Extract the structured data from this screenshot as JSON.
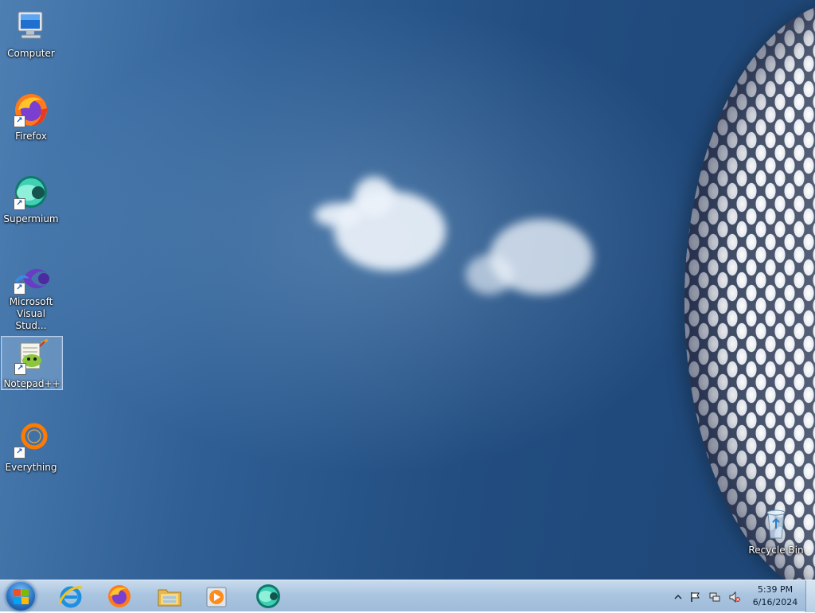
{
  "desktop": {
    "icons": [
      {
        "label": "Computer",
        "icon": "computer-icon"
      },
      {
        "label": "Firefox",
        "icon": "firefox-icon"
      },
      {
        "label": "Supermium",
        "icon": "supermium-icon"
      },
      {
        "label_line1": "Microsoft",
        "label_line2": "Visual Stud...",
        "icon": "visual-studio-icon"
      },
      {
        "label": "Notepad++",
        "icon": "notepad-plus-plus-icon",
        "selected": true
      },
      {
        "label": "Everything",
        "icon": "everything-icon"
      },
      {
        "label": "Recycle Bin",
        "icon": "recycle-bin-icon"
      }
    ]
  },
  "taskbar": {
    "start": {
      "icon": "windows-start-icon"
    },
    "pinned": [
      {
        "icon": "internet-explorer-icon"
      },
      {
        "icon": "firefox-icon"
      },
      {
        "icon": "file-explorer-icon"
      },
      {
        "icon": "media-player-icon"
      },
      {
        "icon": "supermium-icon"
      }
    ],
    "tray": {
      "icons": [
        "show-hidden-icons-chevron",
        "action-center-flag-icon",
        "network-icon",
        "volume-muted-icon"
      ],
      "time": "5:39 PM",
      "date": "6/16/2024"
    },
    "colors": {
      "accent": "#2a72c2",
      "bar": "#aac5e0"
    }
  }
}
